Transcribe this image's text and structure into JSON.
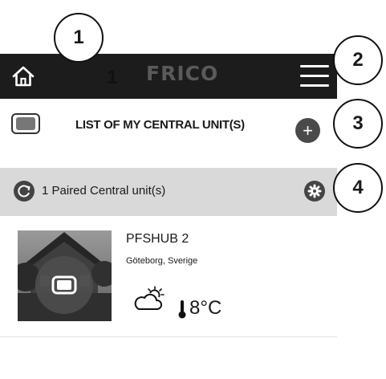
{
  "header": {
    "logo_text": "FRICO",
    "inline_marker": "1"
  },
  "icons": {
    "home": "home-icon",
    "menu": "hamburger-menu-icon",
    "unit": "central-unit-icon",
    "add": "plus-icon",
    "refresh": "refresh-icon",
    "settings": "gear-icon",
    "weather": "partly-cloudy-icon",
    "thermometer": "thermometer-icon"
  },
  "list": {
    "title": "LIST OF MY CENTRAL UNIT(S)",
    "add_label": "+"
  },
  "paired": {
    "text": "1 Paired Central unit(s)"
  },
  "hub": {
    "name": "PFSHUB 2",
    "location": "Göteborg, Sverige",
    "temperature": "8°C"
  },
  "callouts": [
    "1",
    "2",
    "3",
    "4"
  ],
  "colors": {
    "topbar": "#1c1c1c",
    "paired_bar": "#d9d9d9",
    "button_dark": "#4a4a4a",
    "logo": "#5a5a5a"
  }
}
